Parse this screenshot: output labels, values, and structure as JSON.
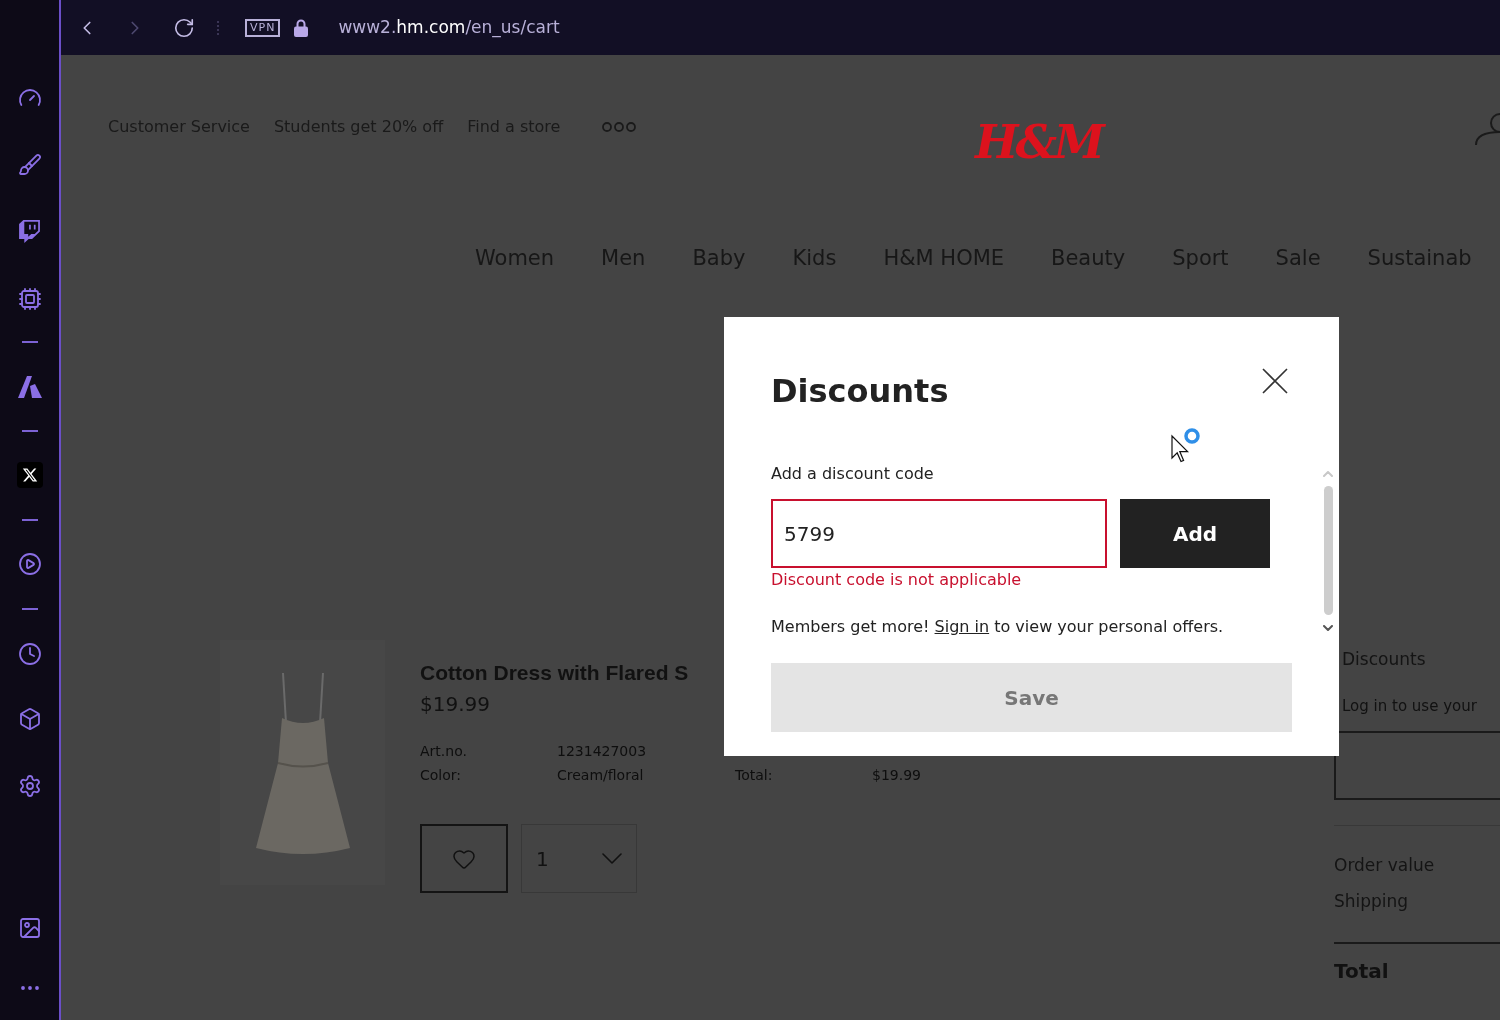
{
  "browser": {
    "vpn_badge": "VPN",
    "url": "www2.**hm.com**/en_us/cart"
  },
  "header": {
    "links": [
      "Customer Service",
      "Students get 20% off",
      "Find a store"
    ],
    "logo": "H&M"
  },
  "nav": {
    "items": [
      "Women",
      "Men",
      "Baby",
      "Kids",
      "H&M HOME",
      "Beauty",
      "Sport",
      "Sale",
      "Sustainab"
    ]
  },
  "cart_item": {
    "title": "Cotton Dress with Flared S",
    "price": "$19.99",
    "details": [
      {
        "label": "Art.no.",
        "value": "1231427003"
      },
      {
        "label": "Color:",
        "value": "Cream/floral"
      }
    ],
    "total": {
      "label": "Total:",
      "value": "$19.99"
    },
    "quantity": "1"
  },
  "summary": {
    "title": "Discounts",
    "login_note": "Log in to use your",
    "rows": [
      "Order value",
      "Shipping"
    ],
    "total_label": "Total"
  },
  "modal": {
    "title": "Discounts",
    "field": {
      "label": "Add a discount code",
      "value": "5799",
      "invalid": true,
      "error": "Discount code is not applicable"
    },
    "add_button": "Add",
    "members_note": {
      "before": "Members get more!",
      "link": "Sign in",
      "after": "to view your personal offers."
    },
    "save_button": {
      "label": "Save",
      "disabled": true
    }
  }
}
